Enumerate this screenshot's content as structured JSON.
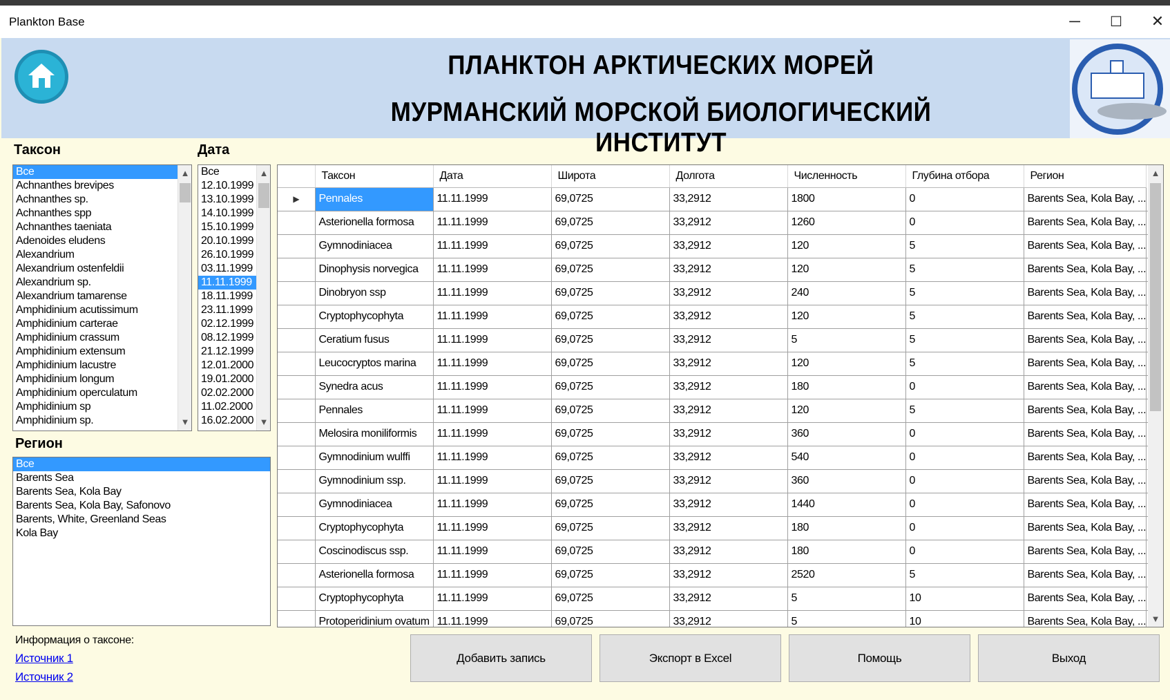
{
  "window": {
    "title": "Plankton Base",
    "minimize_glyph": "─",
    "maximize_glyph": "☐",
    "close_glyph": "✕"
  },
  "header": {
    "line1": "ПЛАНКТОН АРКТИЧЕСКИХ МОРЕЙ",
    "line2": "МУРМАНСКИЙ МОРСКОЙ БИОЛОГИЧЕСКИЙ ИНСТИТУТ",
    "home_icon": "home-icon",
    "logo_icon": "institute-logo",
    "accent": "#c8daf0"
  },
  "taxon": {
    "label": "Таксон",
    "items": [
      "Все",
      "Achnanthes brevipes",
      "Achnanthes sp.",
      "Achnanthes spp",
      "Achnanthes taeniata",
      "Adenoides eludens",
      "Alexandrium",
      "Alexandrium ostenfeldii",
      "Alexandrium sp.",
      "Alexandrium tamarense",
      "Amphidinium acutissimum",
      "Amphidinium carterae",
      "Amphidinium crassum",
      "Amphidinium extensum",
      "Amphidinium lacustre",
      "Amphidinium longum",
      "Amphidinium operculatum",
      "Amphidinium sp",
      "Amphidinium sp."
    ],
    "selected": "Все"
  },
  "date": {
    "label": "Дата",
    "items": [
      "Все",
      "12.10.1999",
      "13.10.1999",
      "14.10.1999",
      "15.10.1999",
      "20.10.1999",
      "26.10.1999",
      "03.11.1999",
      "11.11.1999",
      "18.11.1999",
      "23.11.1999",
      "02.12.1999",
      "08.12.1999",
      "21.12.1999",
      "12.01.2000",
      "19.01.2000",
      "02.02.2000",
      "11.02.2000",
      "16.02.2000"
    ],
    "selected": "11.11.1999"
  },
  "region": {
    "label": "Регион",
    "items": [
      "Все",
      "Barents Sea",
      "Barents Sea, Kola Bay",
      "Barents Sea, Kola Bay, Safonovo",
      "Barents, White, Greenland Seas",
      "Kola Bay"
    ],
    "selected": "Все"
  },
  "grid": {
    "columns": [
      "Таксон",
      "Дата",
      "Широта",
      "Долгота",
      "Численность",
      "Глубина отбора",
      "Регион"
    ],
    "current_row_marker": "▶",
    "rows": [
      [
        "Pennales",
        "11.11.1999",
        "69,0725",
        "33,2912",
        "1800",
        "0",
        "Barents Sea, Kola Bay, ..."
      ],
      [
        "Asterionella formosa",
        "11.11.1999",
        "69,0725",
        "33,2912",
        "1260",
        "0",
        "Barents Sea, Kola Bay, ..."
      ],
      [
        "Gymnodiniacea",
        "11.11.1999",
        "69,0725",
        "33,2912",
        "120",
        "5",
        "Barents Sea, Kola Bay, ..."
      ],
      [
        "Dinophysis norvegica",
        "11.11.1999",
        "69,0725",
        "33,2912",
        "120",
        "5",
        "Barents Sea, Kola Bay, ..."
      ],
      [
        "Dinobryon ssp",
        "11.11.1999",
        "69,0725",
        "33,2912",
        "240",
        "5",
        "Barents Sea, Kola Bay, ..."
      ],
      [
        "Cryptophycophyta",
        "11.11.1999",
        "69,0725",
        "33,2912",
        "120",
        "5",
        "Barents Sea, Kola Bay, ..."
      ],
      [
        "Ceratium fusus",
        "11.11.1999",
        "69,0725",
        "33,2912",
        "5",
        "5",
        "Barents Sea, Kola Bay, ..."
      ],
      [
        "Leucocryptos marina",
        "11.11.1999",
        "69,0725",
        "33,2912",
        "120",
        "5",
        "Barents Sea, Kola Bay, ..."
      ],
      [
        "Synedra acus",
        "11.11.1999",
        "69,0725",
        "33,2912",
        "180",
        "0",
        "Barents Sea, Kola Bay, ..."
      ],
      [
        "Pennales",
        "11.11.1999",
        "69,0725",
        "33,2912",
        "120",
        "5",
        "Barents Sea, Kola Bay, ..."
      ],
      [
        "Melosira moniliformis",
        "11.11.1999",
        "69,0725",
        "33,2912",
        "360",
        "0",
        "Barents Sea, Kola Bay, ..."
      ],
      [
        "Gymnodinium wulffi",
        "11.11.1999",
        "69,0725",
        "33,2912",
        "540",
        "0",
        "Barents Sea, Kola Bay, ..."
      ],
      [
        "Gymnodinium ssp.",
        "11.11.1999",
        "69,0725",
        "33,2912",
        "360",
        "0",
        "Barents Sea, Kola Bay, ..."
      ],
      [
        "Gymnodiniacea",
        "11.11.1999",
        "69,0725",
        "33,2912",
        "1440",
        "0",
        "Barents Sea, Kola Bay, ..."
      ],
      [
        "Cryptophycophyta",
        "11.11.1999",
        "69,0725",
        "33,2912",
        "180",
        "0",
        "Barents Sea, Kola Bay, ..."
      ],
      [
        "Coscinodiscus ssp.",
        "11.11.1999",
        "69,0725",
        "33,2912",
        "180",
        "0",
        "Barents Sea, Kola Bay, ..."
      ],
      [
        "Asterionella formosa",
        "11.11.1999",
        "69,0725",
        "33,2912",
        "2520",
        "5",
        "Barents Sea, Kola Bay, ..."
      ],
      [
        "Cryptophycophyta",
        "11.11.1999",
        "69,0725",
        "33,2912",
        "5",
        "10",
        "Barents Sea, Kola Bay, ..."
      ],
      [
        "Protoperidinium ovatum",
        "11.11.1999",
        "69,0725",
        "33,2912",
        "5",
        "10",
        "Barents Sea, Kola Bay, ..."
      ]
    ]
  },
  "info": {
    "label": "Информация о таксоне:",
    "source1": "Источник 1",
    "source2": "Источник 2"
  },
  "buttons": {
    "add": "Добавить запись",
    "export": "Экспорт в Excel",
    "help": "Помощь",
    "exit": "Выход"
  }
}
